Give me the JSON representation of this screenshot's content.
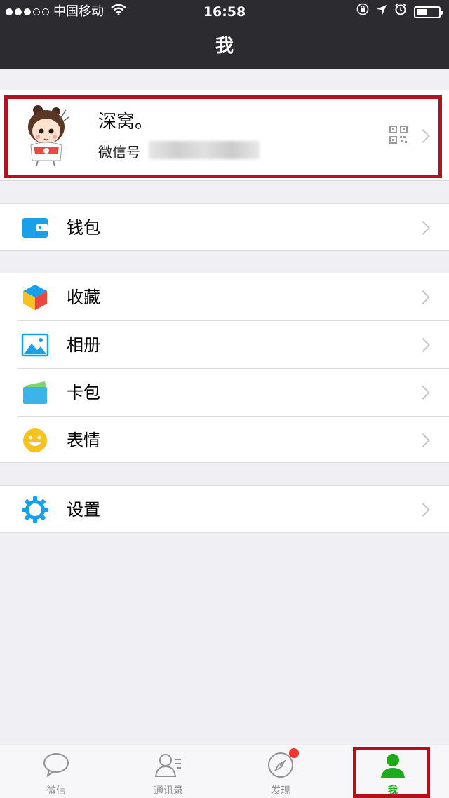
{
  "status_bar": {
    "carrier": "中国移动",
    "time": "16:58"
  },
  "header": {
    "title": "我"
  },
  "profile": {
    "name": "深窝。",
    "wechat_id_label": "微信号",
    "icons": [
      "avatar",
      "qr-code-icon",
      "chevron-right-icon"
    ]
  },
  "menu": {
    "wallet": {
      "label": "钱包",
      "icon": "wallet-icon"
    },
    "favorites": {
      "label": "收藏",
      "icon": "favorites-cube-icon"
    },
    "album": {
      "label": "相册",
      "icon": "album-icon"
    },
    "cards": {
      "label": "卡包",
      "icon": "card-wallet-icon"
    },
    "stickers": {
      "label": "表情",
      "icon": "smiley-icon"
    },
    "settings": {
      "label": "设置",
      "icon": "gear-icon"
    }
  },
  "tabbar": {
    "tabs": [
      {
        "label": "微信",
        "icon": "chat-bubble-icon"
      },
      {
        "label": "通讯录",
        "icon": "contacts-icon"
      },
      {
        "label": "发现",
        "icon": "compass-icon"
      },
      {
        "label": "我",
        "icon": "person-icon"
      }
    ],
    "active_index": 3
  },
  "colors": {
    "accent_green": "#1aad19",
    "highlight_red": "#b3121d",
    "header_bg": "#2b2b30",
    "badge_red": "#f43530"
  }
}
